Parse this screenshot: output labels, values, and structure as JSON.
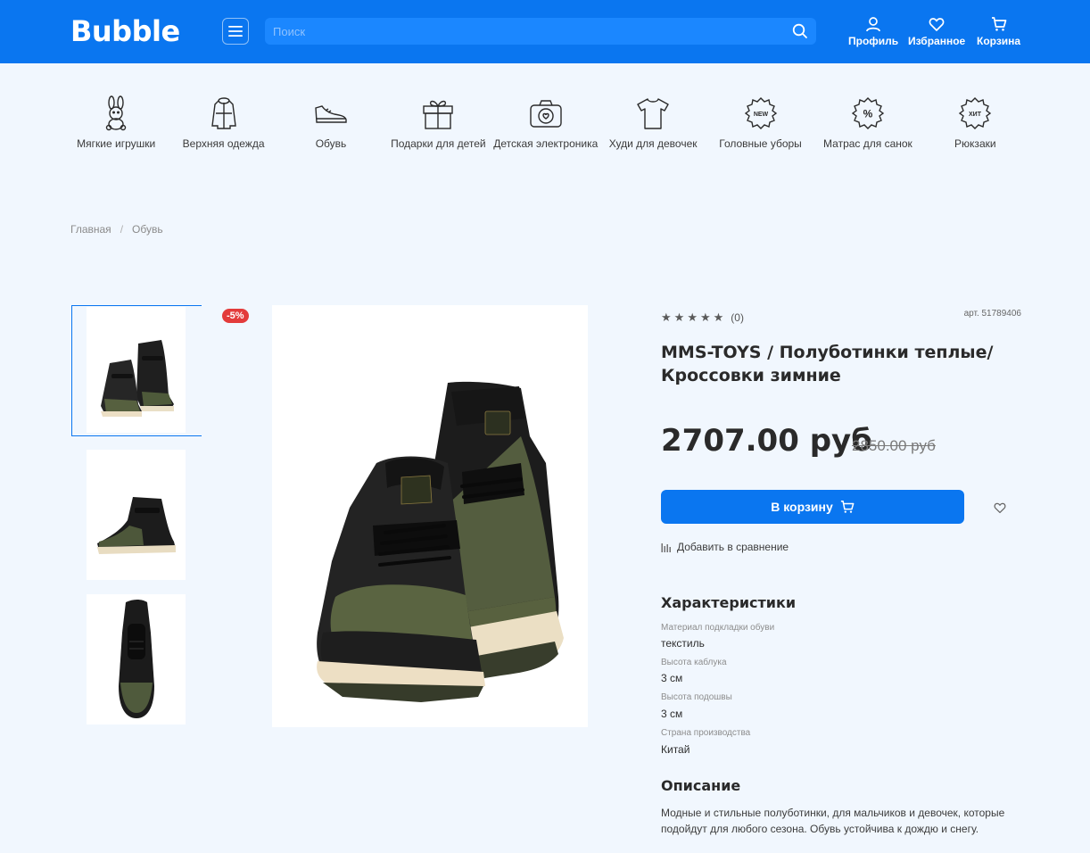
{
  "header": {
    "logo": "Bubble",
    "search_placeholder": "Поиск",
    "nav": {
      "profile": "Профиль",
      "favorites": "Избранное",
      "cart": "Корзина"
    }
  },
  "categories": [
    {
      "label": "Мягкие игрушки",
      "icon": "bunny-icon"
    },
    {
      "label": "Верхняя одежда",
      "icon": "jacket-icon"
    },
    {
      "label": "Обувь",
      "icon": "sneaker-icon"
    },
    {
      "label": "Подарки для детей",
      "icon": "gift-icon"
    },
    {
      "label": "Детская электроника",
      "icon": "camera-icon"
    },
    {
      "label": "Худи для девочек",
      "icon": "tshirt-icon"
    },
    {
      "label": "Головные уборы",
      "icon": "new-badge-icon",
      "badge_text": "NEW"
    },
    {
      "label": "Матрас для санок",
      "icon": "percent-badge-icon",
      "badge_text": "%"
    },
    {
      "label": "Рюкзаки",
      "icon": "hit-badge-icon",
      "badge_text": "ХИТ"
    }
  ],
  "breadcrumb": {
    "home": "Главная",
    "separator": "/",
    "current": "Обувь"
  },
  "gallery": {
    "discount_badge": "-5%"
  },
  "product": {
    "rating_count": "(0)",
    "sku": "арт. 51789406",
    "title": "MMS-TOYS / Полуботинки теплые/ Кроссовки зимние",
    "price": "2707.00 руб",
    "old_price": "2850.00 руб",
    "cart_button": "В корзину",
    "compare_link": "Добавить в сравнение",
    "stars": 0
  },
  "specs": {
    "heading": "Характеристики",
    "items": [
      {
        "label": "Материал подкладки обуви",
        "value": "текстиль"
      },
      {
        "label": "Высота каблука",
        "value": "3 см"
      },
      {
        "label": "Высота подошвы",
        "value": "3 см"
      },
      {
        "label": "Страна производства",
        "value": "Китай"
      }
    ]
  },
  "description": {
    "heading": "Описание",
    "text": "Модные и стильные полуботинки, для мальчиков и девочек, которые подойдут для любого сезона. Обувь устойчива к дождю и снегу."
  },
  "colors": {
    "brand": "#0a76f0",
    "search_bg": "#1b87ff",
    "page_bg": "#f1f7fe",
    "badge": "#e33b3b"
  }
}
